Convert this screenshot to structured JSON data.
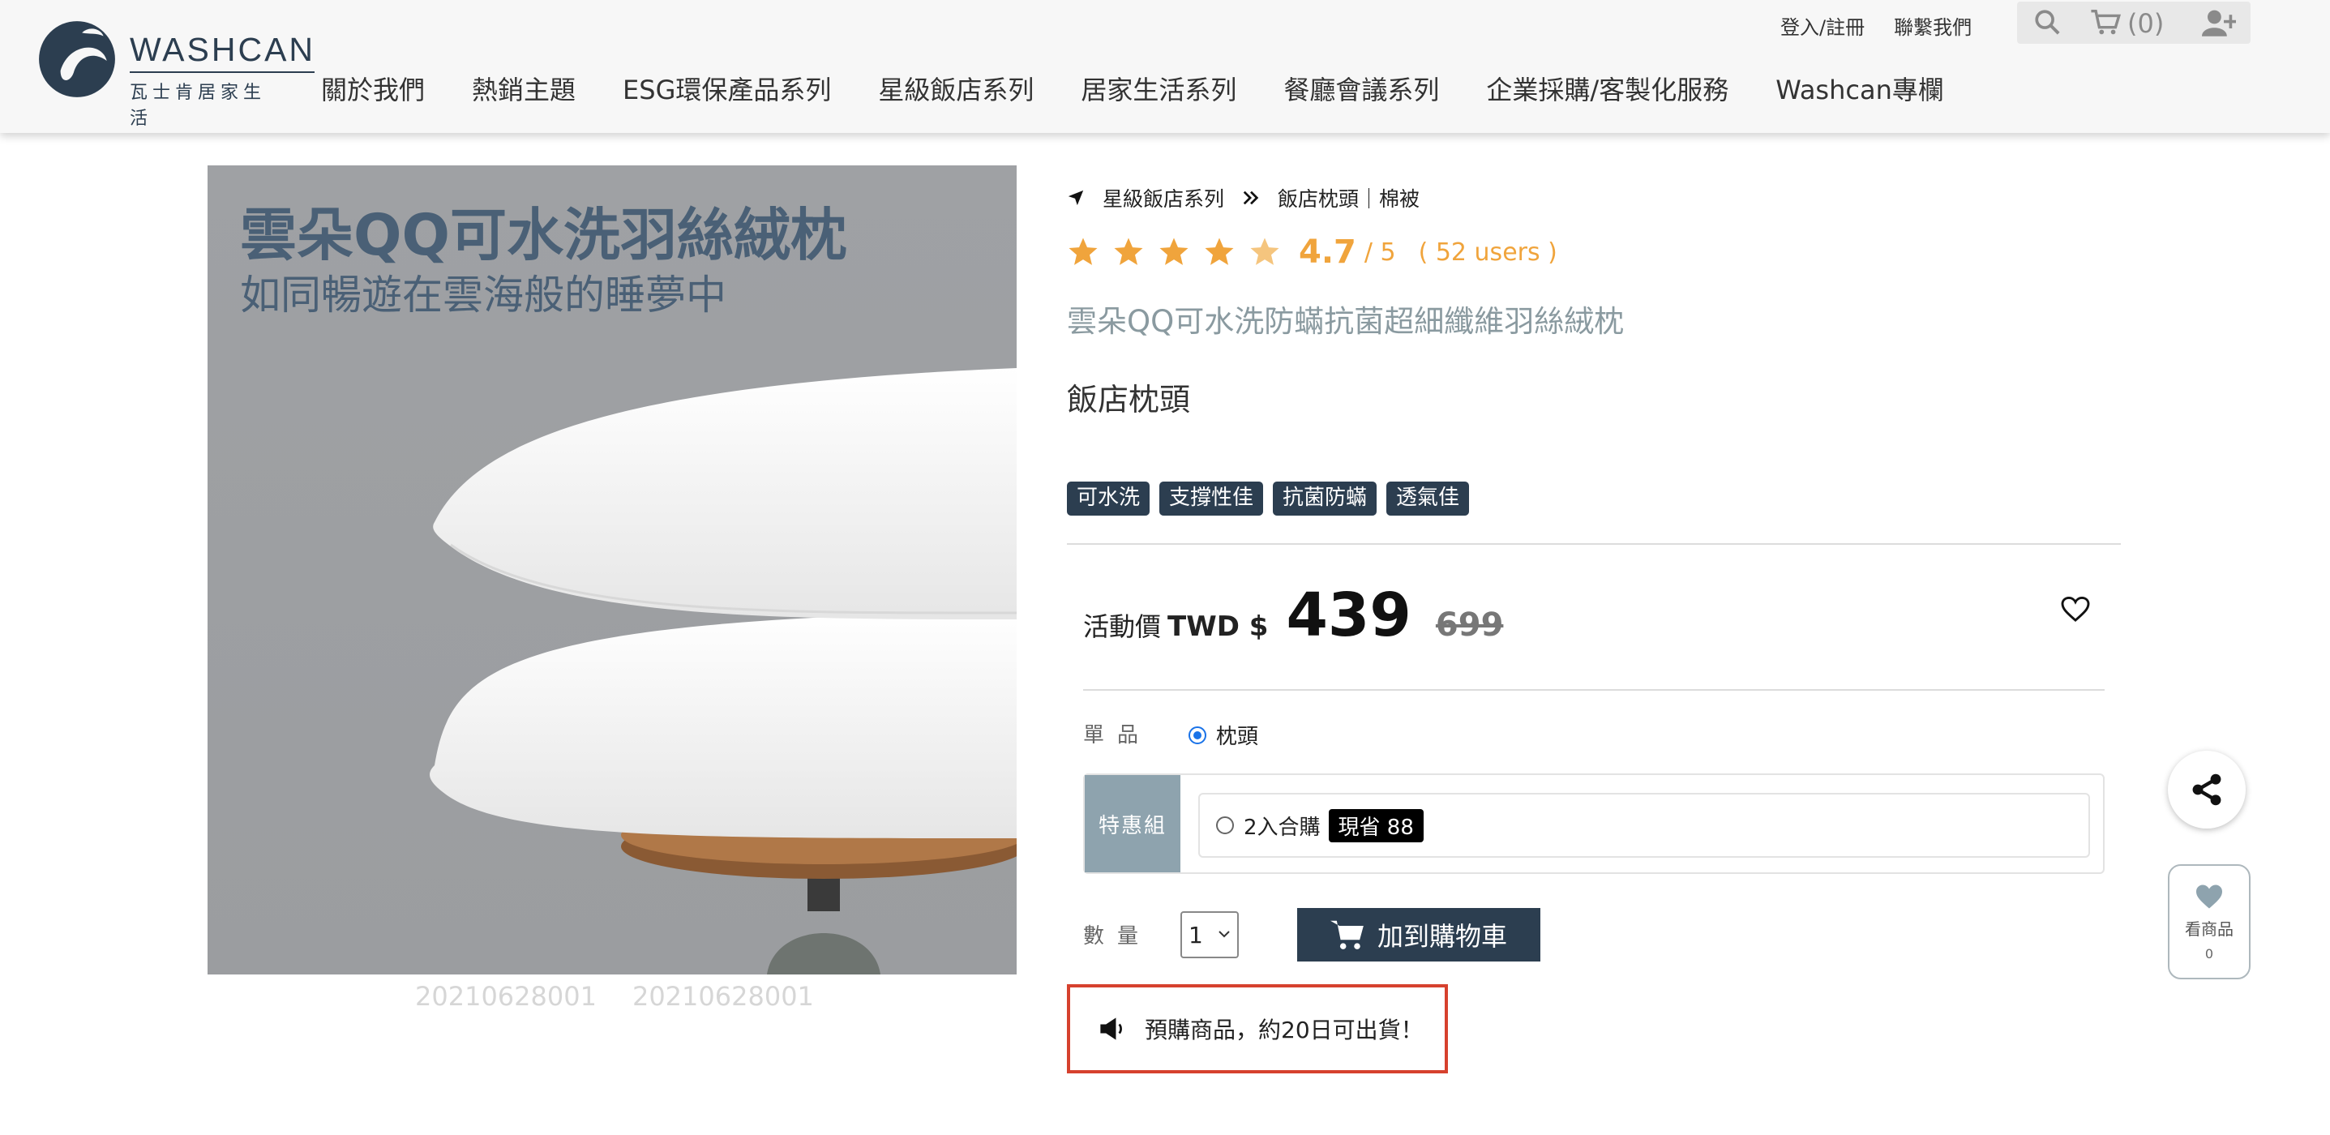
{
  "header": {
    "brand_name": "WASHCAN",
    "brand_sub": "瓦士肯居家生活",
    "top_links": [
      "登入/註冊",
      "聯繫我們"
    ],
    "cart_count": "(0)",
    "nav": [
      "關於我們",
      "熱銷主題",
      "ESG環保產品系列",
      "星級飯店系列",
      "居家生活系列",
      "餐廳會議系列",
      "企業採購/客製化服務",
      "Washcan專欄"
    ]
  },
  "product_image": {
    "headline": "雲朵QQ可水洗羽絲絨枕",
    "subline": "如同暢遊在雲海般的睡夢中",
    "sku_codes": [
      "20210628001",
      "20210628001"
    ]
  },
  "breadcrumb": [
    "星級飯店系列",
    "飯店枕頭｜棉被"
  ],
  "rating": {
    "score": "4.7",
    "out_of": "/ 5",
    "users": "( 52 users )",
    "stars_value": 4.7,
    "star_color": "#f0a43c"
  },
  "product": {
    "name": "雲朵QQ可水洗防蟎抗菌超細纖維羽絲絨枕",
    "category": "飯店枕頭",
    "tags": [
      "可水洗",
      "支撐性佳",
      "抗菌防蟎",
      "透氣佳"
    ]
  },
  "price": {
    "label": "活動價",
    "currency": "TWD $",
    "current": "439",
    "original": "699"
  },
  "options": {
    "single_label": "單品",
    "single_choice": "枕頭",
    "bundle_label": "特惠組",
    "bundle_choice": "2入合購",
    "bundle_badge": "現省 88",
    "qty_label": "數量",
    "qty_value": "1"
  },
  "add_to_cart": "加到購物車",
  "notice": "預購商品，約20日可出貨！",
  "side": {
    "wishlist_label": "看商品",
    "wishlist_count": "0"
  },
  "colors": {
    "brand_dark": "#2c3e50",
    "accent_orange": "#f0a43c",
    "notice_border": "#d6412e",
    "bundle_side": "#8ea3ae"
  }
}
